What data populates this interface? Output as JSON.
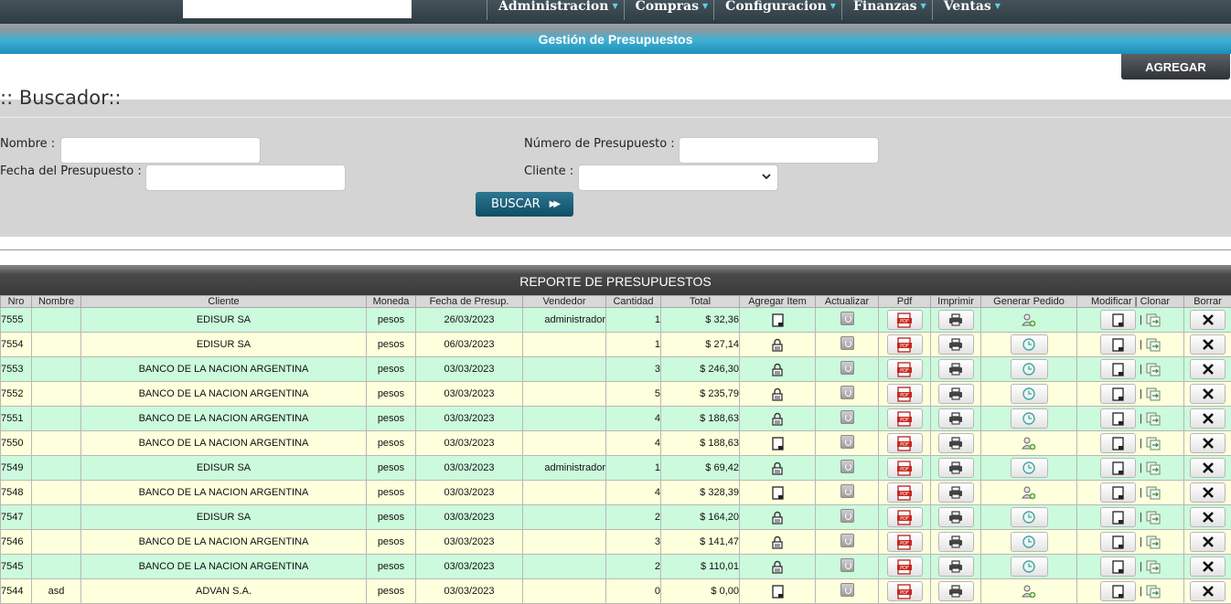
{
  "nav": {
    "menu": [
      {
        "label": "Administracion"
      },
      {
        "label": "Compras"
      },
      {
        "label": "Configuracion"
      },
      {
        "label": "Finanzas"
      },
      {
        "label": "Ventas"
      }
    ],
    "caret_icon": "triangle-down-icon",
    "accent_color": "#5fd0e8"
  },
  "page": {
    "title": "Gestión de Presupuestos",
    "add_label": "AGREGAR"
  },
  "search": {
    "heading": ":: Buscador::",
    "nombre_label": "Nombre :",
    "nombre_value": "",
    "fecha_label": "Fecha del Presupuesto :",
    "fecha_value": "",
    "numero_label": "Número de Presupuesto :",
    "numero_value": "",
    "cliente_label": "Cliente :",
    "cliente_selected": "",
    "buscar_label": "BUSCAR"
  },
  "report": {
    "title": "REPORTE DE PRESUPUESTOS",
    "columns": [
      "Nro",
      "Nombre",
      "Cliente",
      "Moneda",
      "Fecha de Presup.",
      "Vendedor",
      "Cantidad",
      "Total",
      "Agregar Item",
      "Actualizar",
      "Pdf",
      "Imprimir",
      "Generar Pedido",
      "Modificar | Clonar",
      "Borrar"
    ],
    "rows": [
      {
        "nro": "7555",
        "nombre": "",
        "cliente": "EDISUR SA",
        "moneda": "pesos",
        "fecha": "26/03/2023",
        "vendedor": "administrador",
        "cantidad": "1",
        "total": "$ 32,36",
        "agregar": "document-icon",
        "pedido": "user-add-icon"
      },
      {
        "nro": "7554",
        "nombre": "",
        "cliente": "EDISUR SA",
        "moneda": "pesos",
        "fecha": "06/03/2023",
        "vendedor": "",
        "cantidad": "1",
        "total": "$ 27,14",
        "agregar": "lock-icon",
        "pedido": "clock-icon"
      },
      {
        "nro": "7553",
        "nombre": "",
        "cliente": "BANCO DE LA NACION ARGENTINA",
        "moneda": "pesos",
        "fecha": "03/03/2023",
        "vendedor": "",
        "cantidad": "3",
        "total": "$ 246,30",
        "agregar": "lock-icon",
        "pedido": "clock-icon"
      },
      {
        "nro": "7552",
        "nombre": "",
        "cliente": "BANCO DE LA NACION ARGENTINA",
        "moneda": "pesos",
        "fecha": "03/03/2023",
        "vendedor": "",
        "cantidad": "5",
        "total": "$ 235,79",
        "agregar": "lock-icon",
        "pedido": "clock-icon"
      },
      {
        "nro": "7551",
        "nombre": "",
        "cliente": "BANCO DE LA NACION ARGENTINA",
        "moneda": "pesos",
        "fecha": "03/03/2023",
        "vendedor": "",
        "cantidad": "4",
        "total": "$ 188,63",
        "agregar": "lock-icon",
        "pedido": "clock-icon"
      },
      {
        "nro": "7550",
        "nombre": "",
        "cliente": "BANCO DE LA NACION ARGENTINA",
        "moneda": "pesos",
        "fecha": "03/03/2023",
        "vendedor": "",
        "cantidad": "4",
        "total": "$ 188,63",
        "agregar": "document-icon",
        "pedido": "user-add-icon"
      },
      {
        "nro": "7549",
        "nombre": "",
        "cliente": "EDISUR SA",
        "moneda": "pesos",
        "fecha": "03/03/2023",
        "vendedor": "administrador",
        "cantidad": "1",
        "total": "$ 69,42",
        "agregar": "lock-icon",
        "pedido": "clock-icon"
      },
      {
        "nro": "7548",
        "nombre": "",
        "cliente": "BANCO DE LA NACION ARGENTINA",
        "moneda": "pesos",
        "fecha": "03/03/2023",
        "vendedor": "",
        "cantidad": "4",
        "total": "$ 328,39",
        "agregar": "document-icon",
        "pedido": "user-add-icon"
      },
      {
        "nro": "7547",
        "nombre": "",
        "cliente": "EDISUR SA",
        "moneda": "pesos",
        "fecha": "03/03/2023",
        "vendedor": "",
        "cantidad": "2",
        "total": "$ 164,20",
        "agregar": "lock-icon",
        "pedido": "clock-icon"
      },
      {
        "nro": "7546",
        "nombre": "",
        "cliente": "BANCO DE LA NACION ARGENTINA",
        "moneda": "pesos",
        "fecha": "03/03/2023",
        "vendedor": "",
        "cantidad": "3",
        "total": "$ 141,47",
        "agregar": "lock-icon",
        "pedido": "clock-icon"
      },
      {
        "nro": "7545",
        "nombre": "",
        "cliente": "BANCO DE LA NACION ARGENTINA",
        "moneda": "pesos",
        "fecha": "03/03/2023",
        "vendedor": "",
        "cantidad": "2",
        "total": "$ 110,01",
        "agregar": "lock-icon",
        "pedido": "clock-icon"
      },
      {
        "nro": "7544",
        "nombre": "asd",
        "cliente": "ADVAN S.A.",
        "moneda": "pesos",
        "fecha": "03/03/2023",
        "vendedor": "",
        "cantidad": "0",
        "total": "$ 0,00",
        "agregar": "document-icon",
        "pedido": "user-add-icon"
      }
    ],
    "row_colors": {
      "even": "#ccfadd",
      "odd": "#feffdc"
    },
    "nro_link_color": "#1c5fa8"
  }
}
